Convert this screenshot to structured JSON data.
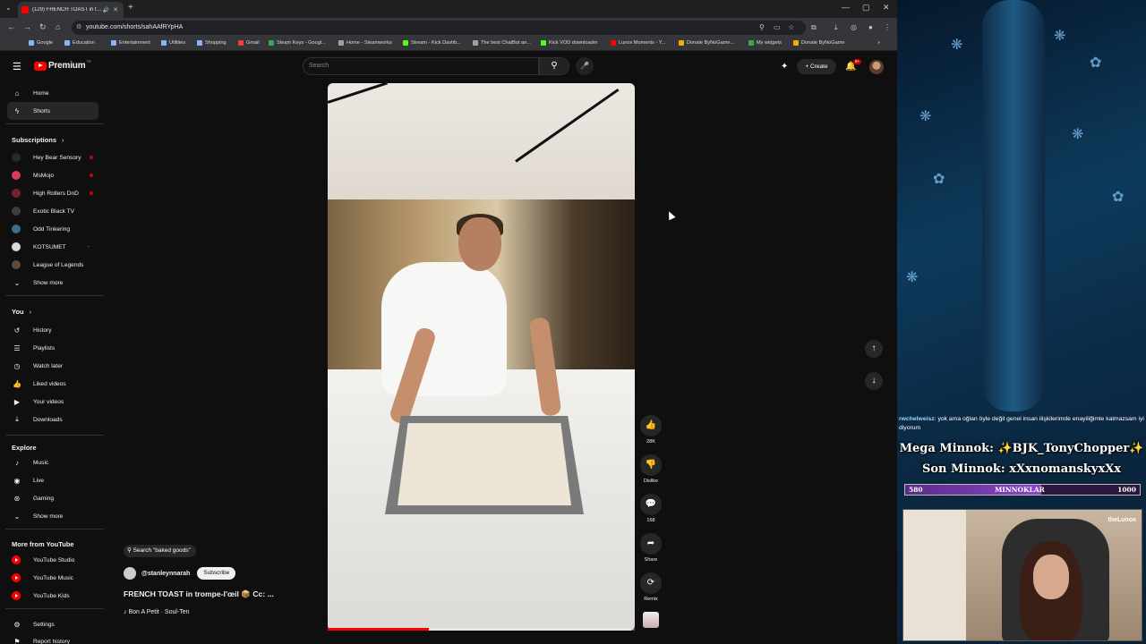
{
  "browser": {
    "tab_title": "(129) FRENCH TOAST in tro...",
    "url": "youtube.com/shorts/sahAAfRYpHA",
    "bookmarks": [
      {
        "label": "Google",
        "color": "#8ab4f8"
      },
      {
        "label": "Education",
        "color": "#8ab4f8"
      },
      {
        "label": "Entertainment",
        "color": "#8ab4f8"
      },
      {
        "label": "Utilities",
        "color": "#8ab4f8"
      },
      {
        "label": "Shopping",
        "color": "#8ab4f8"
      },
      {
        "label": "Gmail",
        "color": "#ea4335"
      },
      {
        "label": "Steam Keys - Googl...",
        "color": "#34a853"
      },
      {
        "label": "Home - Steamworks",
        "color": "#9aa0a6"
      },
      {
        "label": "Stream - Kick Dashb...",
        "color": "#53fc18"
      },
      {
        "label": "The best ChatBot an...",
        "color": "#9aa0a6"
      },
      {
        "label": "Kick VOD downloader",
        "color": "#53fc18"
      },
      {
        "label": "Lunox Moments - Y...",
        "color": "#ff0000"
      },
      {
        "label": "Donate ByNoGame...",
        "color": "#f9ab00"
      },
      {
        "label": "My widgets",
        "color": "#34a853"
      },
      {
        "label": "Donate ByNoGame",
        "color": "#f9ab00"
      }
    ]
  },
  "header": {
    "logo_text": "Premium",
    "search_placeholder": "Search",
    "create_label": "Create",
    "notif_count": "9+"
  },
  "sidebar": {
    "main": [
      {
        "label": "Home",
        "icon": "⌂"
      },
      {
        "label": "Shorts",
        "icon": "ϟ"
      }
    ],
    "subscriptions_title": "Subscriptions",
    "subscriptions": [
      {
        "label": "Hey Bear Sensory",
        "color": "#2a2a2a",
        "badge": "live"
      },
      {
        "label": "MsMojo",
        "color": "#d63b5b",
        "badge": "live"
      },
      {
        "label": "High Rollers DnD",
        "color": "#7a1f2b",
        "badge": "live"
      },
      {
        "label": "Exotic Black TV",
        "color": "#3d3d3d",
        "badge": ""
      },
      {
        "label": "Odd Tinkering",
        "color": "#3b6e8f",
        "badge": ""
      },
      {
        "label": "KOTSUMET",
        "color": "#d9d9d9",
        "badge": "dash"
      },
      {
        "label": "League of Legends",
        "color": "#5e4b3a",
        "badge": ""
      }
    ],
    "subs_show_more": "Show more",
    "you_title": "You",
    "you": [
      {
        "label": "History",
        "icon": "↺"
      },
      {
        "label": "Playlists",
        "icon": "☰"
      },
      {
        "label": "Watch later",
        "icon": "◷"
      },
      {
        "label": "Liked videos",
        "icon": "👍"
      },
      {
        "label": "Your videos",
        "icon": "▶"
      },
      {
        "label": "Downloads",
        "icon": "⤓"
      }
    ],
    "explore_title": "Explore",
    "explore": [
      {
        "label": "Music",
        "icon": "♪"
      },
      {
        "label": "Live",
        "icon": "◉"
      },
      {
        "label": "Gaming",
        "icon": "⊛"
      }
    ],
    "explore_show_more": "Show more",
    "more_title": "More from YouTube",
    "more": [
      {
        "label": "YouTube Studio"
      },
      {
        "label": "YouTube Music"
      },
      {
        "label": "YouTube Kids"
      }
    ],
    "settings_label": "Settings",
    "report_label": "Report history"
  },
  "short": {
    "search_chip": "Search \"baked goods\"",
    "channel": "@stanleynnarah",
    "subscribe": "Subscribe",
    "title": "FRENCH TOAST  in trompe-l'œil 📦 Cc: ...",
    "sound": "Bon A Petit · Soul-Ten",
    "progress": 0.33
  },
  "actions": {
    "like_count": "28K",
    "dislike_label": "Dislike",
    "comment_count": "168",
    "share_label": "Share",
    "remix_label": "Remix"
  },
  "stream": {
    "chat_user": "rwchelweisz",
    "chat_text": ": yok ama oğlan öyle değil genel insan ilişkilerimde enayiliğimle kalmazsam iyi diyorum",
    "line1": "Mega Minnok: ✨BJK_TonyChopper✨",
    "line2": "Son Minnok: xXxnomanskyxXx",
    "goal_start": "580",
    "goal_label": "MINNOKLAR",
    "goal_end": "1000",
    "cam_logo": "theLunox"
  }
}
